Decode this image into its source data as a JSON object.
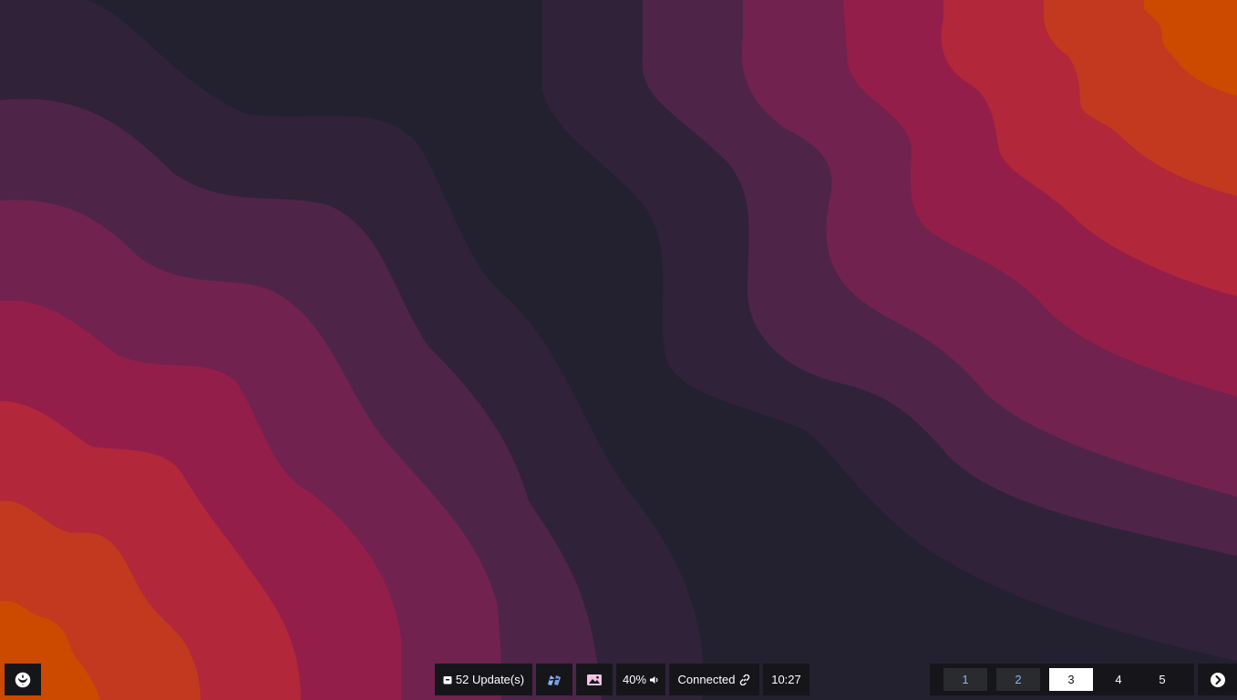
{
  "desktop": {
    "wallpaper_colors": [
      "#23212f",
      "#302239",
      "#4f2449",
      "#72224e",
      "#941e4a",
      "#b2273a",
      "#c3391f",
      "#cc4a00"
    ]
  },
  "taskbar": {
    "launcher_icon": "rebel-alliance-icon",
    "updates": {
      "icon": "package-icon",
      "label": "52 Update(s)"
    },
    "screenshot_icon": "screenshot-tool-icon",
    "wallpaper_icon": "image-icon",
    "volume": {
      "label": "40%",
      "icon": "speaker-icon"
    },
    "network": {
      "label": "Connected",
      "icon": "link-icon"
    },
    "clock": {
      "time": "10:27"
    },
    "workspaces": [
      {
        "label": "1",
        "state": "occupied"
      },
      {
        "label": "2",
        "state": "occupied"
      },
      {
        "label": "3",
        "state": "active"
      },
      {
        "label": "4",
        "state": "empty"
      },
      {
        "label": "5",
        "state": "empty"
      }
    ],
    "next_icon": "chevron-right-circle-icon",
    "colors": {
      "bar_bg": "#16161a",
      "workspace_occupied_text": "#89b4fa",
      "workspace_active_bg": "#ffffff",
      "screenshot_icon": "#89b4fa",
      "wallpaper_icon": "#f5c2e7"
    }
  }
}
